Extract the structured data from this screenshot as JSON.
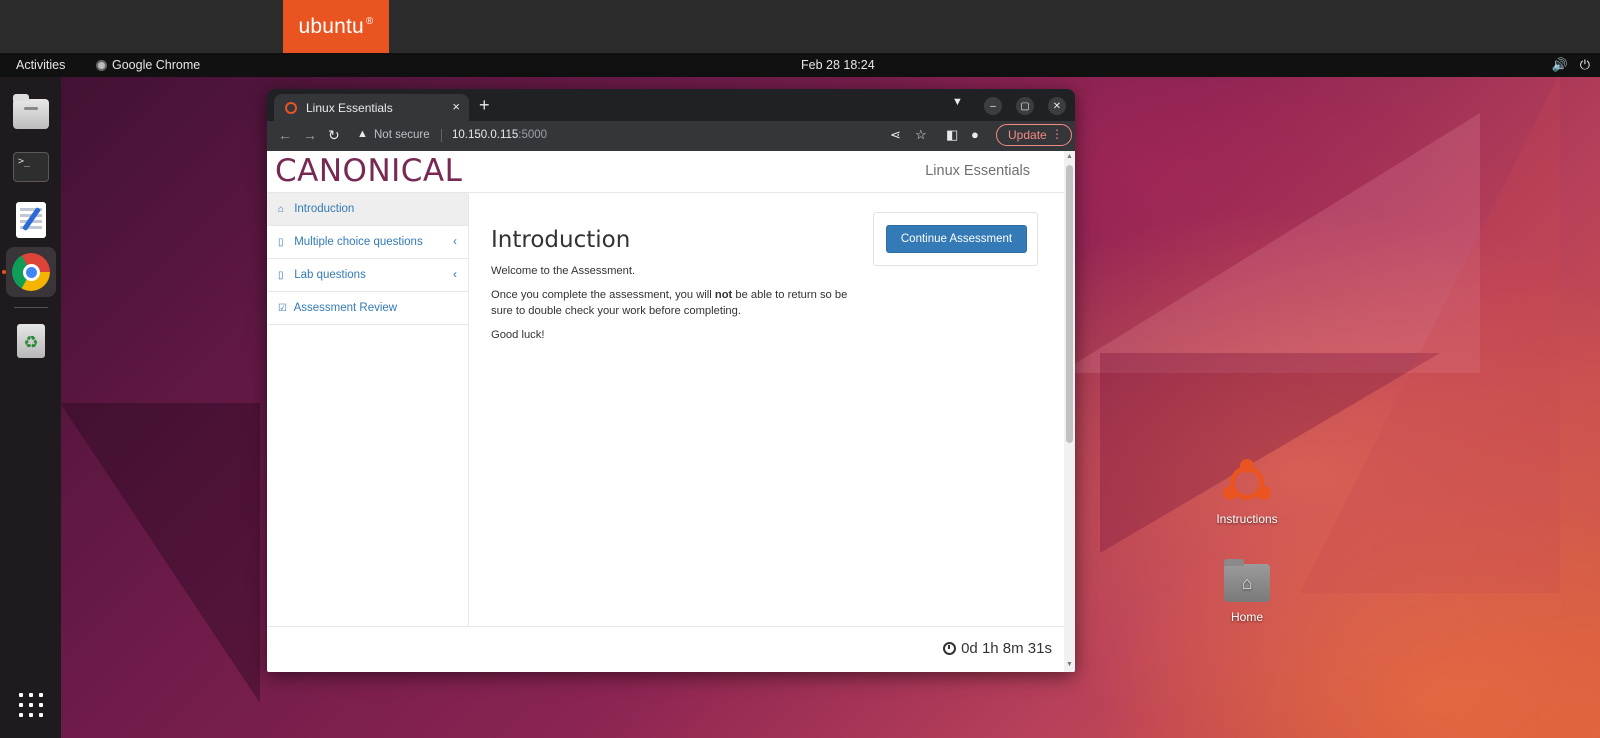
{
  "host": {
    "badge": "ubuntu"
  },
  "panel": {
    "activities": "Activities",
    "app_name": "Google Chrome",
    "clock": "Feb 28  18:24",
    "volume_icon": "🔊",
    "power_icon": "⏻"
  },
  "dock": {
    "items": [
      "files",
      "terminal",
      "text-editor",
      "chrome",
      "trash"
    ],
    "terminal_glyph": ">_",
    "trash_glyph": "♻"
  },
  "desktop_icons": {
    "instructions": "Instructions",
    "home": "Home"
  },
  "browser": {
    "tab_title": "Linux Essentials",
    "close_glyph": "×",
    "new_tab_glyph": "+",
    "security_label": "Not secure",
    "url_host": "10.150.0.115",
    "url_port": ":5000",
    "update_label": "Update",
    "update_menu_glyph": "⋮"
  },
  "site": {
    "logo": "CANONICAL",
    "brand": "Linux Essentials",
    "sidebar": [
      {
        "label": "Introduction",
        "icon": "home-icon",
        "glyph": "⌂",
        "active": true
      },
      {
        "label": "Multiple choice questions",
        "icon": "file-icon",
        "glyph": "▯",
        "chevron": "‹"
      },
      {
        "label": "Lab questions",
        "icon": "file-icon",
        "glyph": "▯",
        "chevron": "‹"
      },
      {
        "label": "Assessment Review",
        "icon": "check-square-icon",
        "glyph": "☑"
      }
    ],
    "heading": "Introduction",
    "welcome": "Welcome to the Assessment.",
    "warning_before": "Once you complete the assessment, you will ",
    "warning_bold": "not",
    "warning_after": " be able to return so be sure to double check your work before completing.",
    "good_luck": "Good luck!",
    "continue_label": "Continue Assessment",
    "timer": "0d 1h 8m 31s"
  },
  "colors": {
    "ubuntu_orange": "#e95420",
    "canonical_aubergine": "#772953",
    "link_blue": "#337ab7",
    "button_blue": "#337ab7"
  }
}
